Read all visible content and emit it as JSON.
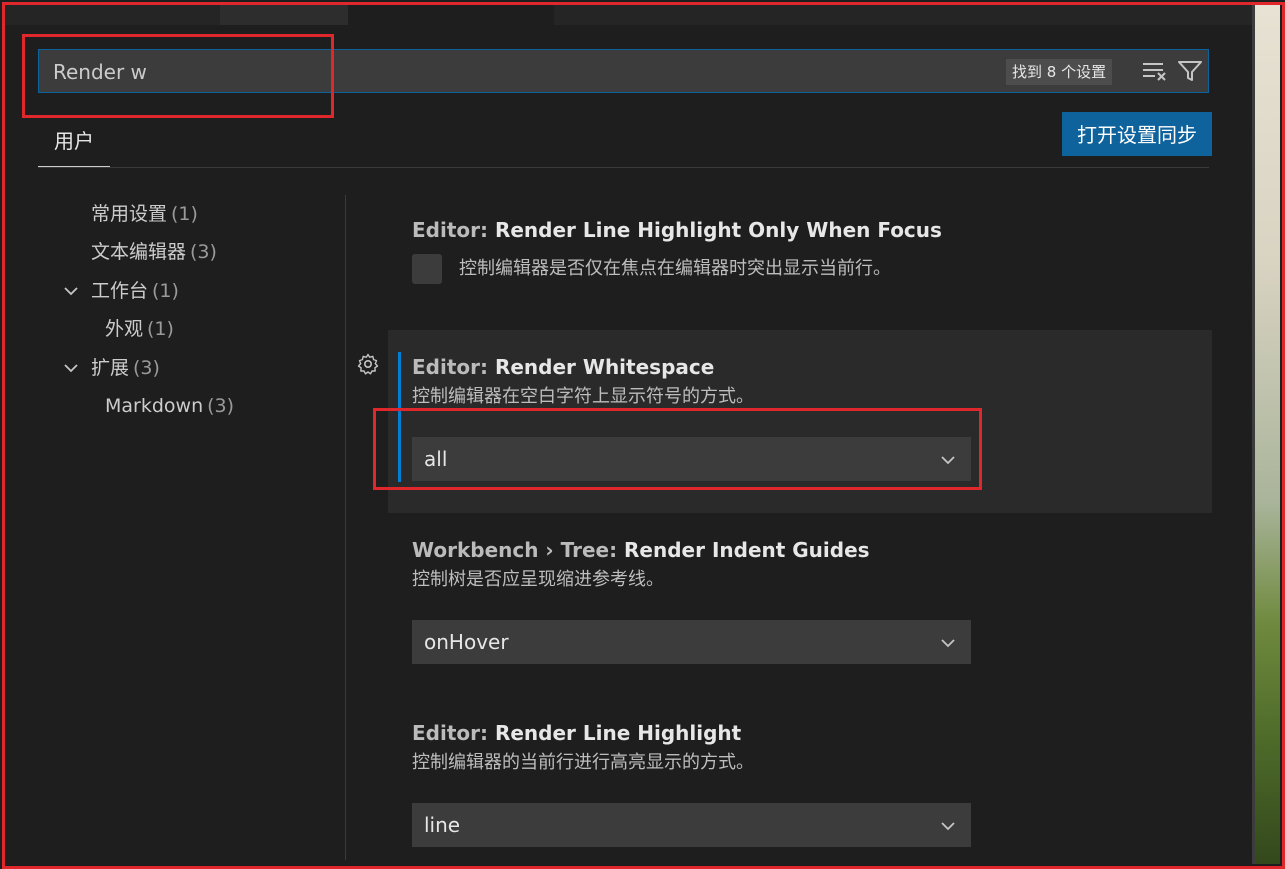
{
  "search": {
    "value": "Render w",
    "result_count": "找到 8 个设置"
  },
  "tabs": {
    "user": "用户"
  },
  "sync_button": "打开设置同步",
  "toc": [
    {
      "label": "常用设置",
      "count": "(1)"
    },
    {
      "label": "文本编辑器",
      "count": "(3)"
    },
    {
      "label": "工作台",
      "count": "(1)"
    },
    {
      "label": "外观",
      "count": "(1)"
    },
    {
      "label": "扩展",
      "count": "(3)"
    },
    {
      "label": "Markdown",
      "count": "(3)"
    }
  ],
  "settings": [
    {
      "category": "Editor: ",
      "name": "Render Line Highlight Only When Focus",
      "description": "控制编辑器是否仅在焦点在编辑器时突出显示当前行。",
      "checked": false
    },
    {
      "category": "Editor: ",
      "name": "Render Whitespace",
      "description": "控制编辑器在空白字符上显示符号的方式。",
      "value": "all"
    },
    {
      "category": "Workbench › Tree: ",
      "name": "Render Indent Guides",
      "description": "控制树是否应呈现缩进参考线。",
      "value": "onHover"
    },
    {
      "category": "Editor: ",
      "name": "Render Line Highlight",
      "description": "控制编辑器的当前行进行高亮显示的方式。",
      "value": "line"
    }
  ],
  "icons": {
    "clear_filter": "clear-filter-icon",
    "filter": "filter-icon",
    "gear": "gear-icon",
    "chevron": "chevron-down-icon"
  },
  "colors": {
    "accent": "#0e639c",
    "focus_bar": "#007fd4",
    "annotation": "#e0272b"
  }
}
